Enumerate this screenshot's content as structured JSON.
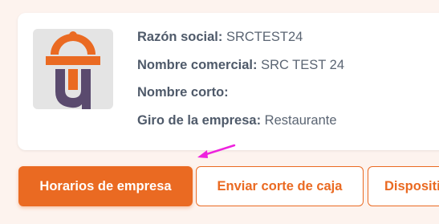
{
  "company": {
    "fields": [
      {
        "label": "Razón social:",
        "value": "SRCTEST24"
      },
      {
        "label": "Nombre comercial:",
        "value": "SRC TEST 24"
      },
      {
        "label": "Nombre corto:",
        "value": ""
      },
      {
        "label": "Giro de la empresa:",
        "value": "Restaurante"
      }
    ],
    "logo": {
      "icon": "restaurant-logo-icon",
      "colors": {
        "orange": "#ea6a22",
        "purple": "#5a4a6e",
        "background": "#e4e4e4"
      }
    }
  },
  "actions": {
    "business_hours_label": "Horarios de empresa",
    "send_cash_cut_label": "Enviar corte de caja",
    "devices_label": "Dispositivos"
  },
  "annotation": {
    "icon": "pointer-arrow-icon",
    "color": "#ee22dd"
  },
  "theme": {
    "accent": "#ea6a22",
    "page_background": "#fdf3ee"
  }
}
